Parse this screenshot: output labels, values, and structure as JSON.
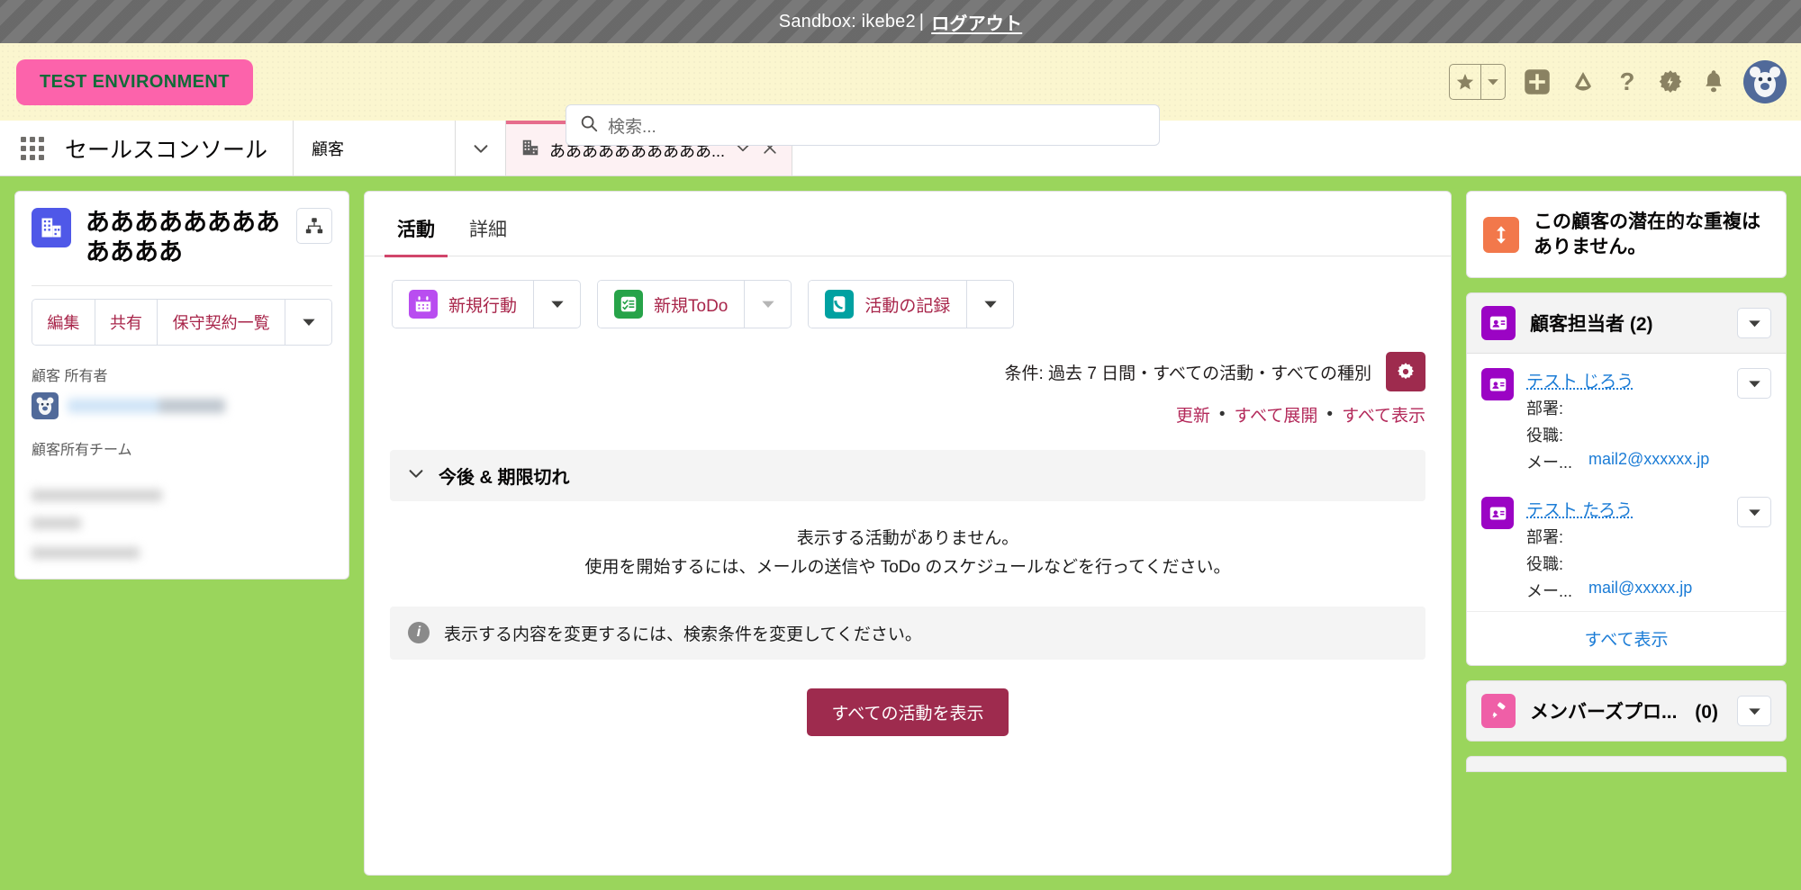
{
  "sandbox": {
    "label": "Sandbox: ikebe2",
    "separator": "|",
    "logout": "ログアウト"
  },
  "header": {
    "test_badge": "TEST ENVIRONMENT",
    "search_placeholder": "検索...",
    "icons": [
      "favorites-star-icon",
      "favorites-dropdown-icon",
      "global-create-icon",
      "nonprofit-cloud-icon",
      "help-icon",
      "setup-gear-icon",
      "notifications-bell-icon",
      "user-avatar"
    ],
    "accent_pink": "#fc63ab",
    "badge_text_color": "#0f6b38",
    "background": "#fbf6cf"
  },
  "appbar": {
    "waffle": "app-launcher-icon",
    "app_name": "セールスコンソール",
    "nav_item": "顧客",
    "nav_chevron": "chevron-down-icon",
    "tab": {
      "icon": "account-icon",
      "title": "ああああああああああ...",
      "chevron": "chevron-down-icon",
      "close": "close-icon"
    }
  },
  "highlights": {
    "object_icon": "account-building-icon",
    "title": "ああああああああああああ",
    "hierarchy_button": "hierarchy-icon",
    "buttons": [
      "編集",
      "共有",
      "保守契約一覧"
    ],
    "more_caret": "chevron-down-icon",
    "owner_label": "顧客 所有者",
    "owner_name_redacted": true,
    "team_label": "顧客所有チーム",
    "team_redacted": true
  },
  "main": {
    "tabs": [
      {
        "label": "活動",
        "active": true
      },
      {
        "label": "詳細",
        "active": false
      }
    ],
    "actions": [
      {
        "label": "新規行動",
        "icon": "calendar-icon",
        "color": "#b94df0"
      },
      {
        "label": "新規ToDo",
        "icon": "task-checklist-icon",
        "color": "#27a349"
      },
      {
        "label": "活動の記録",
        "icon": "log-call-icon",
        "color": "#00a1a1"
      }
    ],
    "filter_text": "条件: 過去 7 日間・すべての活動・すべての種別",
    "filter_gear": "filter-settings-gear-icon",
    "links": [
      "更新",
      "すべて展開",
      "すべて表示"
    ],
    "link_separator": "•",
    "accordion": {
      "chevron": "chevron-down-icon",
      "title": "今後 & 期限切れ"
    },
    "empty_line1": "表示する活動がありません。",
    "empty_line2": "使用を開始するには、メールの送信や ToDo のスケジュールなどを行ってください。",
    "info_icon": "info-icon",
    "info_text": "表示する内容を変更するには、検索条件を変更してください。",
    "show_all_button": "すべての活動を表示",
    "brand_color": "#9e2b4e"
  },
  "right": {
    "duplicate": {
      "icon": "merge-duplicate-icon",
      "text": "この顧客の潜在的な重複はありません。"
    },
    "contacts_panel": {
      "icon": "contact-card-icon",
      "title": "顧客担当者 (2)",
      "caret": "chevron-down-icon",
      "rows": [
        {
          "name": "テスト じろう",
          "dept_label": "部署:",
          "dept_value": "",
          "title_label": "役職:",
          "title_value": "",
          "email_label": "メー...",
          "email_value": "mail2@xxxxxx.jp",
          "caret": "chevron-down-icon"
        },
        {
          "name": "テスト たろう",
          "dept_label": "部署:",
          "dept_value": "",
          "title_label": "役職:",
          "title_value": "",
          "email_label": "メー...",
          "email_value": "mail@xxxxx.jp",
          "caret": "chevron-down-icon"
        }
      ],
      "view_all": "すべて表示"
    },
    "members_panel": {
      "icon": "brush-icon",
      "title": "メンバーズプロ...",
      "count": "(0)",
      "caret": "chevron-down-icon"
    }
  },
  "theme": {
    "page_background": "#9ad55c",
    "tab_accent": "#e66d8c"
  }
}
